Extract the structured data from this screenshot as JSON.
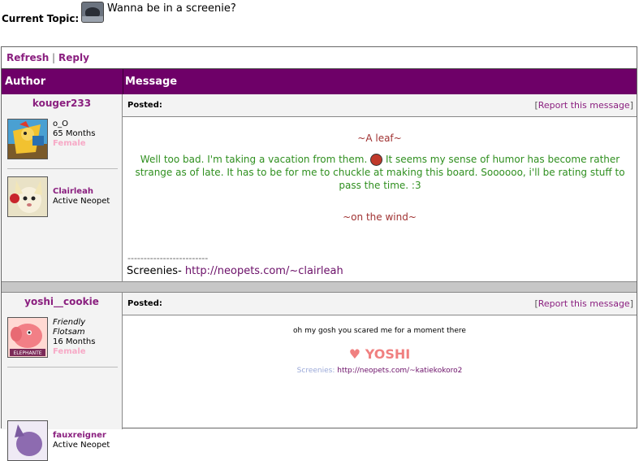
{
  "topic": {
    "label": "Current Topic:",
    "title": "Wanna be in a screenie?",
    "icon": "robot-face-icon"
  },
  "actions": {
    "refresh": "Refresh",
    "separator": "|",
    "reply": "Reply"
  },
  "table_header": {
    "author": "Author",
    "message": "Message"
  },
  "posts": [
    {
      "author": "kouger233",
      "pet_icon": "kougra-knight-pet-icon",
      "status": "o_O",
      "months": "65 Months",
      "gender": "Female",
      "neopet_name": "Clairleah",
      "neopet_status": "Active Neopet",
      "neopet_icon": "usul-pet-icon",
      "posted_label": "Posted:",
      "report_open": "[",
      "report_label": "Report this message",
      "report_close": "]",
      "lines": [
        "~A leaf~",
        "Well too bad. I'm taking a vacation from them.",
        "It seems my sense of humor has become rather strange as of late. It has to be for me to chuckle at making this board. Soooooo, i'll be rating stuff to pass the time. :3",
        "~on the wind~"
      ],
      "sig_divider": "-------------------------",
      "sig_label": "Screenies-",
      "sig_link": "http://neopets.com/~clairleah",
      "colors": {
        "leaf": "#a03232",
        "text": "#2f8f1f"
      }
    },
    {
      "author": "yoshi__cookie",
      "pet_icon": "elephante-pet-icon",
      "status_line1": "Friendly",
      "status_line2": "Flotsam",
      "months": "16 Months",
      "gender": "Female",
      "neopet_name": "fauxreigner",
      "neopet_status": "Active Neopet",
      "neopet_icon": "purple-pet-icon",
      "posted_label": "Posted:",
      "report_open": "[",
      "report_label": "Report this message",
      "report_close": "]",
      "message": "oh my gosh you scared me for a moment there",
      "heart": "♥",
      "yoshi": "YOSHI",
      "sig_label": "Screenies:",
      "sig_link": "http://neopets.com/~katiekokoro2"
    }
  ]
}
